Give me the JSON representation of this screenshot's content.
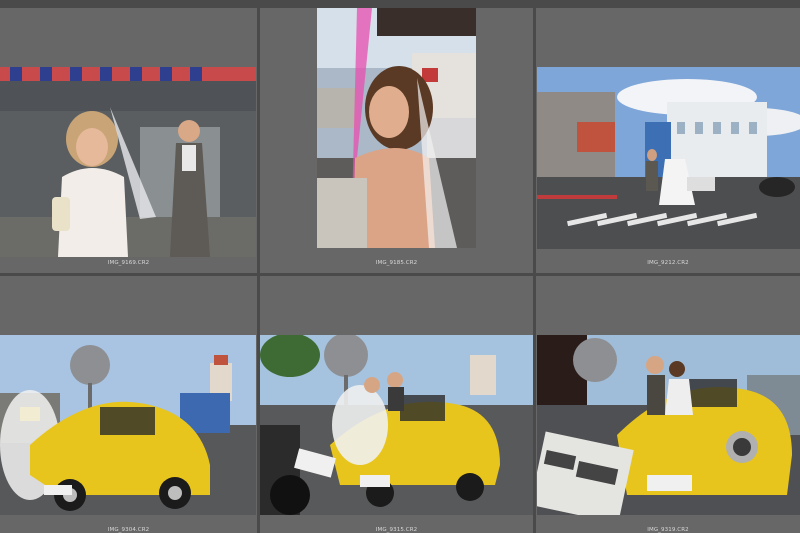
{
  "grid": {
    "thumbnails": [
      {
        "filename": "IMG_9169.CR2"
      },
      {
        "filename": "IMG_9185.CR2"
      },
      {
        "filename": "IMG_9212.CR2"
      },
      {
        "filename": "IMG_9304.CR2"
      },
      {
        "filename": "IMG_9315.CR2"
      },
      {
        "filename": "IMG_9319.CR2"
      }
    ]
  },
  "colors": {
    "cell_bg": "#676767",
    "gutter": "#4a4a4a",
    "car_yellow": "#e8c51c"
  }
}
